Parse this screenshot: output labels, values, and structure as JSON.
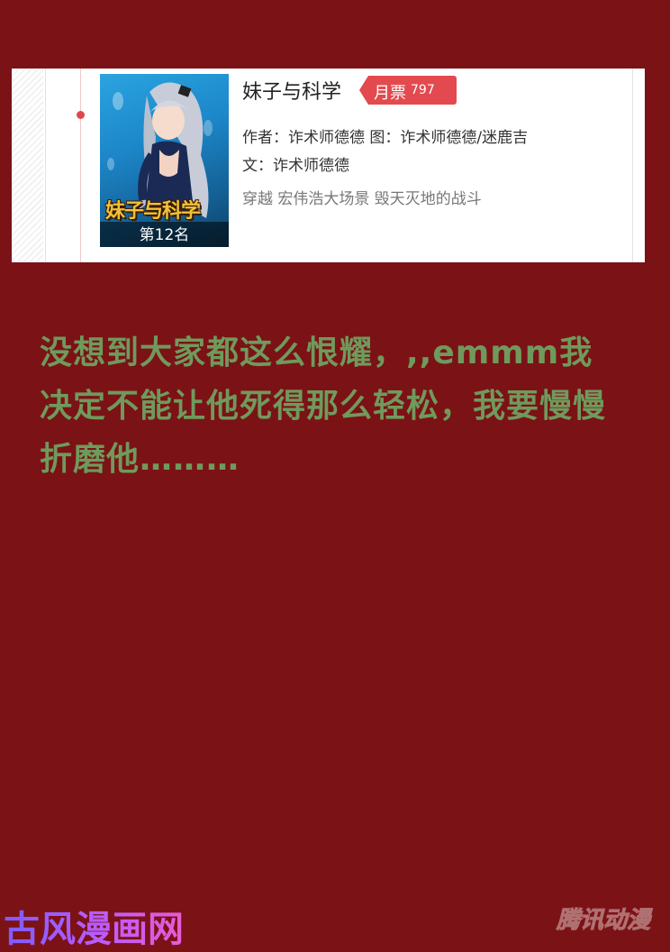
{
  "card": {
    "title": "妹子与科学",
    "ticket_label": "月票",
    "ticket_count": "797",
    "author_line": "作者：诈术师德德  图：诈术师德德/迷鹿吉",
    "writer_line": "文：诈术师德德",
    "tags": "穿越  宏伟浩大场景  毁天灭地的战斗",
    "cover_logo": "妹子与科学",
    "cover_rank": "第12名"
  },
  "message": "没想到大家都这么恨耀，,,emmm我决定不能让他死得那么轻松，我要慢慢折磨他………",
  "watermark_left": "古风漫画网",
  "watermark_right": "腾讯动漫",
  "colors": {
    "background": "#7b1216",
    "message_text": "#6f9a5c",
    "ticket": "#e24a4f"
  }
}
